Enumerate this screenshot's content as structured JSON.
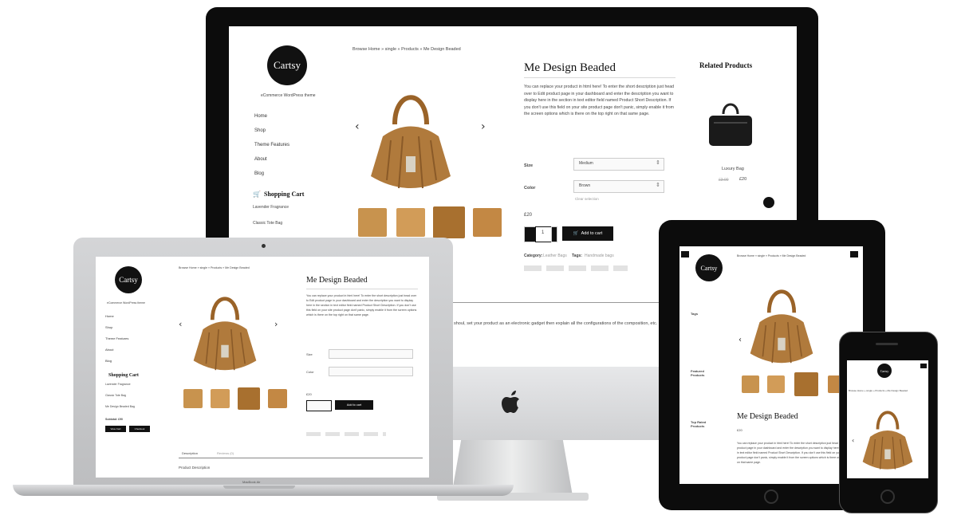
{
  "brand": {
    "logo_text": "Cartsy",
    "tagline": "eCommerce WordPress theme"
  },
  "breadcrumb": "Browse Home  »  single  »  Products  »  Me Design Beaded",
  "product": {
    "title": "Me Design Beaded",
    "description": "You can replace your product in html here! To enter the short description just head over to Edit product page in your dashboard and enter the description you want to display here in the section in text editor field named Product Short Description. If you don't use this field on your site product page don't panic, simply enable it from the screen options which is there on the top right on that same page.",
    "size_label": "Size",
    "size_placeholder": "Medium",
    "color_label": "Color",
    "color_placeholder": "Brown",
    "clear_link": "Clear selection",
    "price": "£20",
    "qty": "1",
    "add_to_cart": "Add to cart",
    "category_label": "Category:",
    "category_value": "Leather Bags",
    "tags_label": "Tags:",
    "tags_value": "Handmade bags"
  },
  "sidebar": {
    "menu": [
      "Home",
      "Shop",
      "Theme Features",
      "About",
      "Blog"
    ],
    "cart_title": "Shopping Cart",
    "cart_items": [
      "Lavender Fragrance",
      "Classic Tote Bag"
    ]
  },
  "related": {
    "title": "Related Products",
    "item_name": "Luxury Bag",
    "old_price": "£3.00",
    "price": "£20"
  },
  "long_text": "shoul, set your product as an electronic gadget then explain all the configurations of the composition, etc. You can add the detailed description in the visual editor on edit",
  "laptop": {
    "model": "MacBook Air",
    "tab_description": "Description",
    "tab_reviews": "Reviews (0)",
    "section_title": "Product Description",
    "cart_item_3": "Me Design Beaded Bag",
    "subtotal": "Subtotal: £90",
    "view_cart": "View Cart",
    "checkout": "Checkout"
  },
  "tablet": {
    "sidebar_headers": [
      "Tags",
      "Featured Products",
      "Top Rated Products"
    ],
    "price": "£20"
  },
  "colors": {
    "bezel": "#0c0c0c",
    "silver": "#cfd0d2",
    "bag": "#b07a3c",
    "accent": "#111111"
  }
}
